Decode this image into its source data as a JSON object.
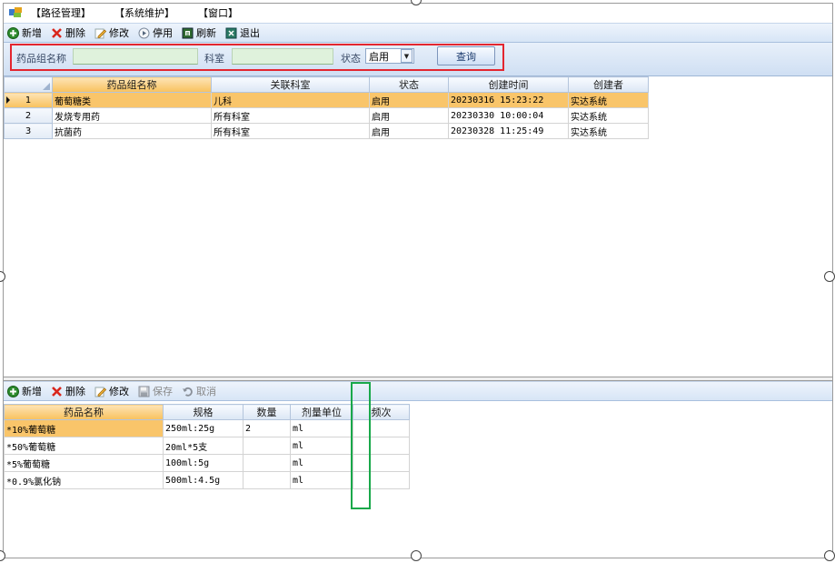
{
  "menu": {
    "items": [
      "【路径管理】",
      "【系统维护】",
      "【窗口】"
    ]
  },
  "toolbar_top": {
    "new": "新增",
    "delete": "删除",
    "edit": "修改",
    "disable": "停用",
    "refresh": "刷新",
    "exit": "退出"
  },
  "filter": {
    "group_name_label": "药品组名称",
    "group_name_value": "",
    "dept_label": "科室",
    "dept_value": "",
    "status_label": "状态",
    "status_value": "启用",
    "query_label": "查询"
  },
  "group_grid": {
    "columns": [
      "药品组名称",
      "关联科室",
      "状态",
      "创建时间",
      "创建者"
    ],
    "rows": [
      {
        "num": "1",
        "name": "葡萄糖类",
        "dept": "儿科",
        "status": "启用",
        "created": "20230316 15:23:22",
        "creator": "实达系统"
      },
      {
        "num": "2",
        "name": "发烧专用药",
        "dept": "所有科室",
        "status": "启用",
        "created": "20230330 10:00:04",
        "creator": "实达系统"
      },
      {
        "num": "3",
        "name": "抗菌药",
        "dept": "所有科室",
        "status": "启用",
        "created": "20230328 11:25:49",
        "creator": "实达系统"
      }
    ]
  },
  "toolbar_bottom": {
    "new": "新增",
    "delete": "删除",
    "edit": "修改",
    "save": "保存",
    "cancel": "取消"
  },
  "drug_grid": {
    "columns": [
      "药品名称",
      "规格",
      "数量",
      "剂量单位",
      "频次"
    ],
    "rows": [
      {
        "name": "*10%葡萄糖",
        "spec": "250ml:25g",
        "qty": "2",
        "unit": "ml",
        "freq": ""
      },
      {
        "name": "*50%葡萄糖",
        "spec": "20ml*5支",
        "qty": "",
        "unit": "ml",
        "freq": ""
      },
      {
        "name": "*5%葡萄糖",
        "spec": "100ml:5g",
        "qty": "",
        "unit": "ml",
        "freq": ""
      },
      {
        "name": "*0.9%氯化钠",
        "spec": "500ml:4.5g",
        "qty": "",
        "unit": "ml",
        "freq": ""
      }
    ]
  },
  "colors": {
    "selection": "#f9c56a",
    "filter_highlight": "#e3262f",
    "column_highlight": "#19a84a",
    "toolbar": "#d7e5f6"
  }
}
